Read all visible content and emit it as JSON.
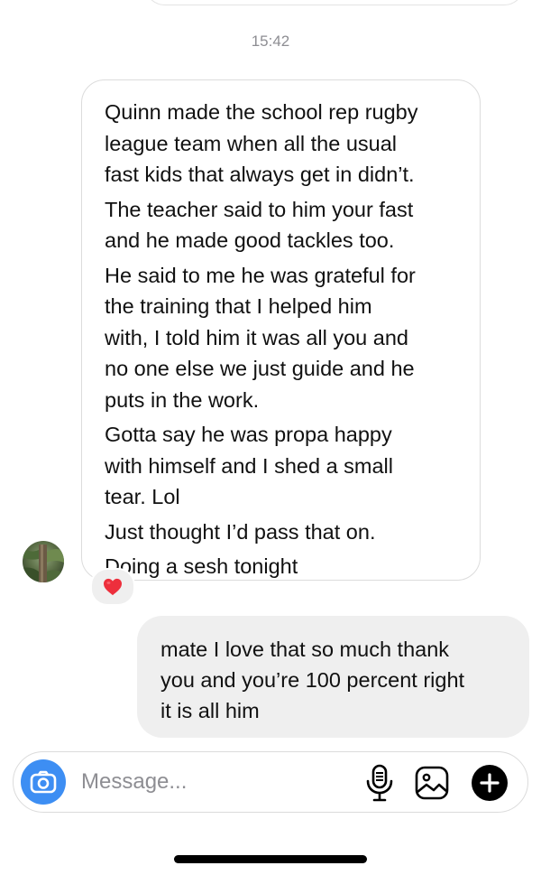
{
  "thread": {
    "timestamp": "15:42",
    "incoming": {
      "paragraphs": [
        "Quinn made the school rep rugby\nleague team when all the usual\nfast kids that always get in didn’t.",
        "The teacher said to him your fast\nand he made good tackles too.",
        "He said to me he was grateful for\nthe training that I helped him\nwith, I told him it was all you and\nno one else we just guide and he\nputs in the work.",
        "Gotta say he was propa happy\nwith himself and I shed a small\ntear. Lol",
        "Just thought I’d pass that on.",
        "Doing a sesh tonight"
      ],
      "reaction": "❤️"
    },
    "outgoing": {
      "text": "mate I love that so much thank\nyou and you’re 100 percent right\nit is all him"
    }
  },
  "composer": {
    "placeholder": "Message...",
    "value": "",
    "icons": {
      "camera": "camera-icon",
      "mic": "microphone-icon",
      "gallery": "gallery-icon",
      "plus": "plus-icon"
    }
  },
  "colors": {
    "camera_blue": "#3d8ef3",
    "outgoing_bg": "#efefef",
    "incoming_border": "#dcdcdc",
    "timestamp_gray": "#8e8e93",
    "heart_red": "#ed2f3c"
  }
}
